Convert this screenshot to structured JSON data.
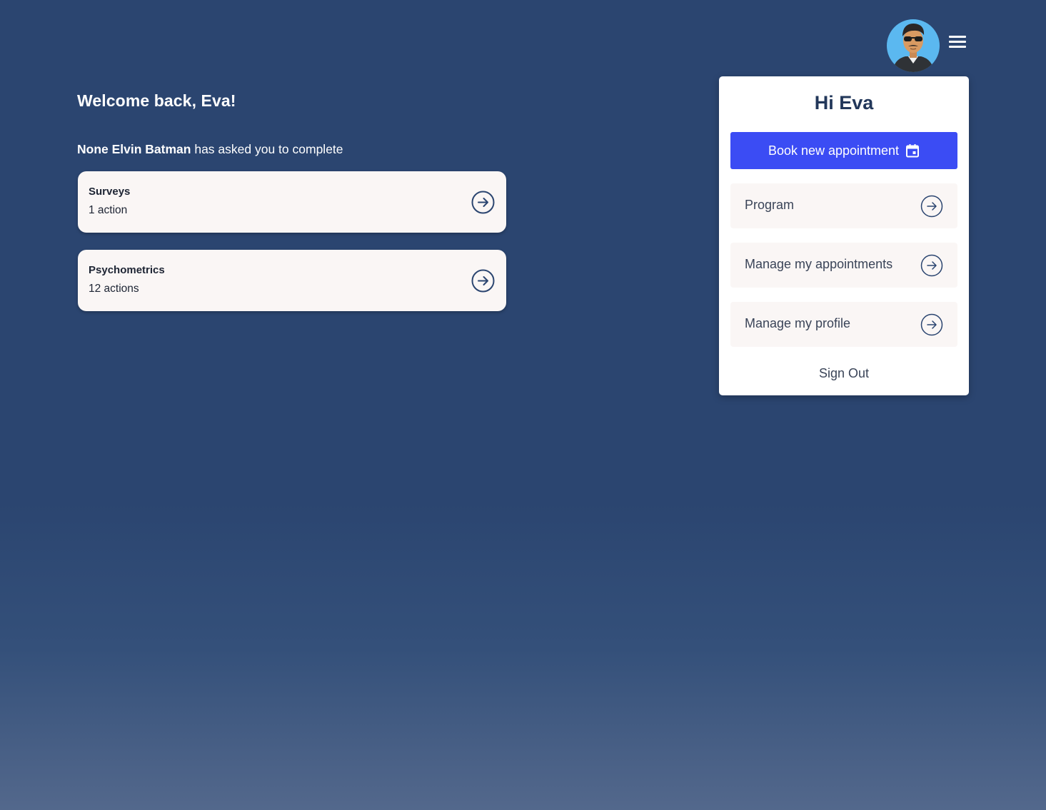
{
  "header": {
    "avatar_icon": "user-avatar-icon",
    "menu_icon": "hamburger-menu-icon"
  },
  "main": {
    "welcome": "Welcome back, Eva!",
    "requester": "None Elvin Batman",
    "request_text": " has asked you to complete",
    "tasks": [
      {
        "title": "Surveys",
        "subtitle": "1 action",
        "icon": "arrow-right-circle-icon"
      },
      {
        "title": "Psychometrics",
        "subtitle": "12 actions",
        "icon": "arrow-right-circle-icon"
      }
    ]
  },
  "panel": {
    "greeting": "Hi Eva",
    "book_button": "Book new appointment",
    "book_icon": "calendar-icon",
    "items": [
      {
        "label": "Program",
        "icon": "arrow-right-circle-icon"
      },
      {
        "label": "Manage my appointments",
        "icon": "arrow-right-circle-icon"
      },
      {
        "label": "Manage my profile",
        "icon": "arrow-right-circle-icon"
      }
    ],
    "sign_out": "Sign Out"
  },
  "colors": {
    "background": "#2b4570",
    "primary_button": "#3b4cf4",
    "card_background": "#faf6f5",
    "heading_text": "#22375a"
  }
}
